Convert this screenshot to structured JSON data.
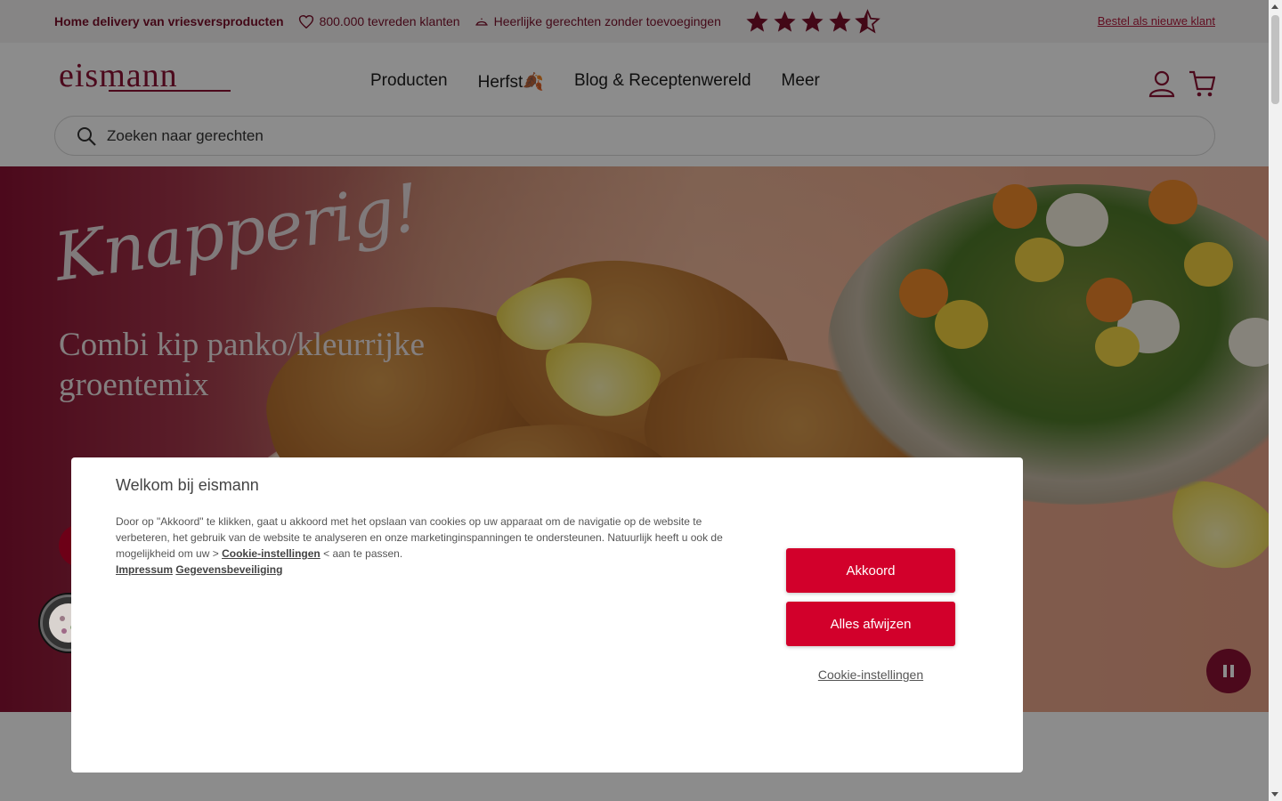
{
  "topbar": {
    "usp_delivery": "Home delivery van vriesversproducten",
    "usp_customers": "800.000 tevreden klanten",
    "usp_recipes": "Heerlijke gerechten zonder toevoegingen",
    "rating_stars": 4.5,
    "new_customer_link": "Bestel als nieuwe klant"
  },
  "header": {
    "logo_text": "eismann",
    "nav": [
      "Producten",
      "Herfst🍂",
      "Blog & Receptenwereld",
      "Meer"
    ],
    "search_placeholder": "Zoeken naar gerechten",
    "icons": [
      "account-icon",
      "cart-icon"
    ]
  },
  "hero": {
    "script_title": "Knapperig!",
    "title": "Combi kip panko/kleurrijke groentemix"
  },
  "cookie_dialog": {
    "title": "Welkom bij eismann",
    "text_before": "Door op \"Akkoord\" te klikken, gaat u akkoord met het opslaan van cookies op uw apparaat om de navigatie op de website te verbeteren, het gebruik van de website te analyseren en onze marketinginspanningen te ondersteunen. Natuurlijk heeft u ook de mogelijkheid om uw >",
    "settings_link_inline": "Cookie-instellingen",
    "text_after": "< aan te passen.",
    "impressum": "Impressum",
    "privacy": "Gegevensbeveiliging",
    "accept": "Akkoord",
    "reject": "Alles afwijzen",
    "settings": "Cookie-instellingen"
  },
  "colors": {
    "brand": "#8a1133",
    "button": "#d2002b",
    "topbar_bg": "#f5f3f3"
  }
}
